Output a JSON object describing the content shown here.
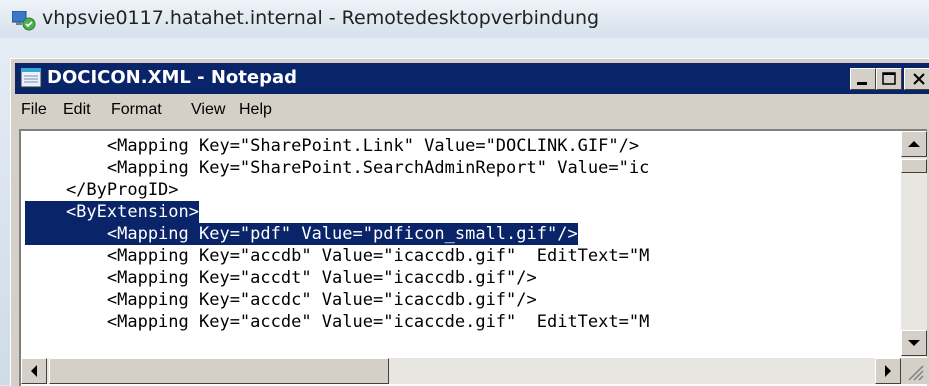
{
  "rdp": {
    "title": "vhpsvie0117.hatahet.internal - Remotedesktopverbindung",
    "icon": "remote-desktop-icon"
  },
  "notepad": {
    "title": "DOCICON.XML - Notepad",
    "icon": "notepad-icon",
    "colors": {
      "titlebar": "#0a246a",
      "selection": "#0a246a",
      "chrome": "#d4d0c8"
    }
  },
  "menu": [
    "File",
    "Edit",
    "Format",
    "View",
    "Help"
  ],
  "editor": {
    "lines": [
      "        <Mapping Key=\"SharePoint.Link\" Value=\"DOCLINK.GIF\"/>",
      "        <Mapping Key=\"SharePoint.SearchAdminReport\" Value=\"ic",
      "    </ByProgID>",
      "    <ByExtension>",
      "        <Mapping Key=\"pdf\" Value=\"pdficon_small.gif\"/>",
      "        <Mapping Key=\"accdb\" Value=\"icaccdb.gif\"  EditText=\"M",
      "        <Mapping Key=\"accdt\" Value=\"icaccdb.gif\"/>",
      "        <Mapping Key=\"accdc\" Value=\"icaccdb.gif\"/>",
      "        <Mapping Key=\"accde\" Value=\"icaccde.gif\"  EditText=\"M"
    ]
  }
}
